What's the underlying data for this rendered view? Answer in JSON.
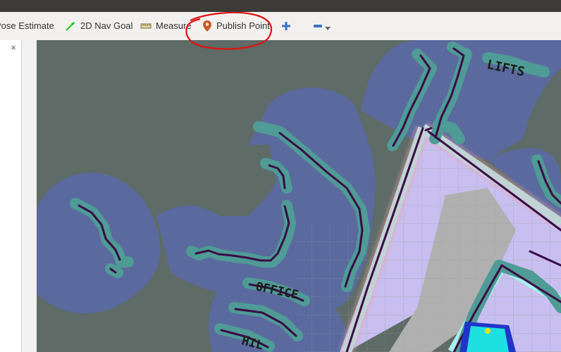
{
  "window": {
    "title_bar_color": "#3c3b37"
  },
  "toolbar": {
    "tools": [
      {
        "label": "Pose Estimate",
        "icon": "pose-arrow-icon"
      },
      {
        "label": "2D Nav Goal",
        "icon": "nav-goal-arrow-icon"
      },
      {
        "label": "Measure",
        "icon": "ruler-icon"
      },
      {
        "label": "Publish Point",
        "icon": "map-pin-icon"
      }
    ],
    "add_tool_icon": "plus-icon",
    "remove_tool_icon": "minus-icon",
    "menu_icon": "chevron-down-icon"
  },
  "side_panel": {
    "close_glyph": "×"
  },
  "map": {
    "labels": {
      "lifts": "LIFTS",
      "office": "OFFICE",
      "partial": "HIL"
    },
    "colors": {
      "unknown": "#5e6b66",
      "inflation": "#5a6a9e",
      "obstacle_cost": "#4f9b96",
      "wall": "#3b0a45",
      "free_cost": "#c8bff0",
      "inscribed": "#a8f0ec"
    }
  },
  "annotation": {
    "color": "#e01010"
  }
}
